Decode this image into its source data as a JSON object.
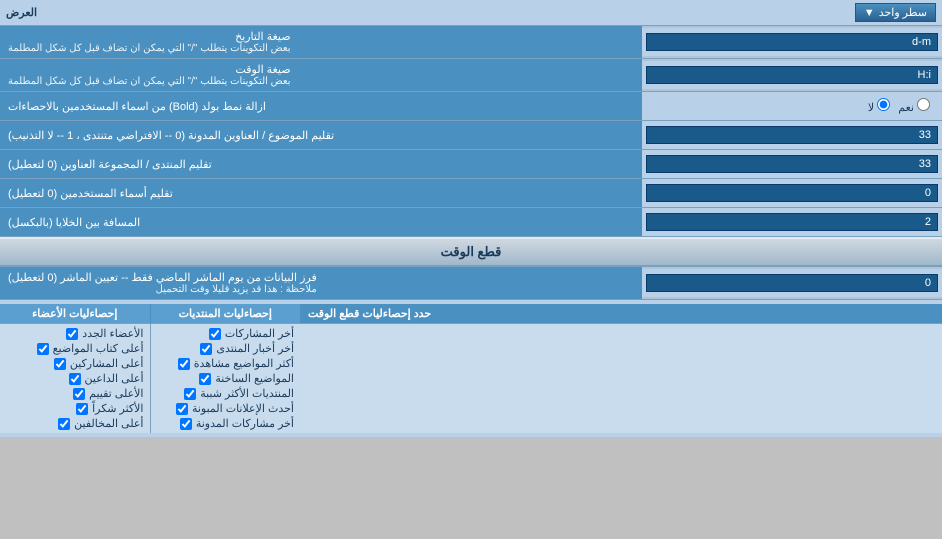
{
  "topRow": {
    "label": "العرض",
    "dropdownLabel": "سطر واحد"
  },
  "rows": [
    {
      "id": "date-format",
      "label": "صيغة التاريخ\nبعض التكوينات يتطلب \"/\" التي يمكن ان تضاف قبل كل شكل المطلمة",
      "labelLine1": "صيغة التاريخ",
      "labelLine2": "بعض التكوينات يتطلب \"/\" التي يمكن ان تضاف قبل كل شكل المطلمة",
      "value": "d-m",
      "type": "input"
    },
    {
      "id": "time-format",
      "label": "صيغة الوقت\nبعض التكوينات يتطلب \"/\" التي يمكن ان تضاف قبل كل شكل المطلمة",
      "labelLine1": "صيغة الوقت",
      "labelLine2": "بعض التكوينات يتطلب \"/\" التي يمكن ان تضاف قبل كل شكل المطلمة",
      "value": "H:i",
      "type": "input"
    },
    {
      "id": "bold-remove",
      "label": "ازالة نمط بولد (Bold) من اسماء المستخدمين بالاحصاءات",
      "labelLine1": "ازالة نمط بولد (Bold) من اسماء المستخدمين بالاحصاءات",
      "labelLine2": "",
      "type": "radio",
      "radioOptions": [
        "نعم",
        "لا"
      ],
      "radioSelected": 1
    },
    {
      "id": "topic-titles",
      "label": "تقليم الموضوع / العناوين المدونة (0 -- الافتراضي متنتدى ، 1 -- لا التذنيب)",
      "labelLine1": "تقليم الموضوع / العناوين المدونة (0 -- الافتراضي متنتدى ، 1 -- لا التذنيب)",
      "value": "33",
      "type": "input"
    },
    {
      "id": "forum-usernames",
      "label": "تقليم المنتدى / المجموعة العناوين (0 لتعطيل)",
      "labelLine1": "تقليم المنتدى / المجموعة العناوين (0 لتعطيل)",
      "value": "33",
      "type": "input"
    },
    {
      "id": "usernames-trim",
      "label": "تقليم أسماء المستخدمين (0 لتعطيل)",
      "labelLine1": "تقليم أسماء المستخدمين (0 لتعطيل)",
      "value": "0",
      "type": "input"
    },
    {
      "id": "cell-spacing",
      "label": "المسافة بين الخلايا (بالبكسل)",
      "labelLine1": "المسافة بين الخلايا (بالبكسل)",
      "value": "2",
      "type": "input"
    }
  ],
  "sectionHeader": "قطع الوقت",
  "cutOffRow": {
    "label": "فرز البيانات من يوم الماشر الماضي فقط -- تعيين الماشر (0 لتعطيل)\nملاحظة : هذا قد يزيد قليلا وقت التحميل",
    "labelLine1": "فرز البيانات من يوم الماشر الماضي فقط -- تعيين الماشر (0 لتعطيل)",
    "labelLine2": "ملاحظة : هذا قد يزيد قليلا وقت التحميل",
    "value": "0"
  },
  "checkboxesSection": {
    "headerLabel": "حدد إحصاءليات قطع الوقت",
    "columns": [
      {
        "header": "إحصاءليات المنتديات",
        "items": [
          "أخر المشاركات",
          "أخر أخبار المنتدى",
          "أكثر المواضيع مشاهدة",
          "المواضيع الساخنة",
          "المنتديات الأكثر شببة",
          "أحدث الإعلانات المبونة",
          "أخر مشاركات المدونة"
        ]
      },
      {
        "header": "إحصاءليات الأعضاء",
        "items": [
          "الأعضاء الجدد",
          "أعلى كتاب المواضيع",
          "أعلى المشاركين",
          "أعلى الداعين",
          "الأعلى تقييم",
          "الأكثر شكراً",
          "أعلى المخالفين"
        ]
      }
    ]
  }
}
